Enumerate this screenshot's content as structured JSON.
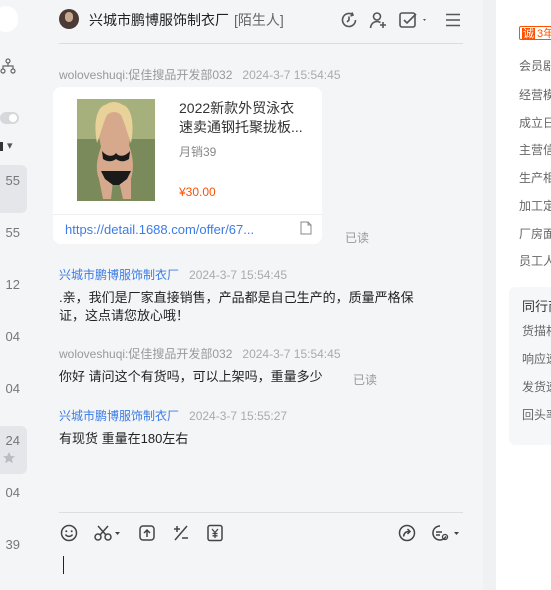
{
  "left_strip": {
    "partial_times": [
      {
        "text": "55",
        "selected": true
      },
      {
        "text": "55",
        "selected": false
      },
      {
        "text": "12",
        "selected": false
      },
      {
        "text": "04",
        "selected": false
      },
      {
        "text": "04",
        "selected": false
      },
      {
        "text": "24",
        "selected": true
      },
      {
        "text": "04",
        "selected": false
      },
      {
        "text": "39",
        "selected": false
      }
    ]
  },
  "header": {
    "title": "兴城市鹏博服饰制衣厂",
    "tag": "[陌生人]",
    "icons": [
      "clock-refresh-icon",
      "add-contact-icon",
      "checklist-icon",
      "menu-icon"
    ]
  },
  "messages": [
    {
      "sender": "woloveshuqi:促佳搜品开发部032",
      "time": "2024-3-7 15:54:45",
      "product_card": {
        "title_line1": "2022新款外贸泳衣",
        "title_line2": "速卖通钢托聚拢板...",
        "sales": "月销39",
        "price": "¥30.00",
        "link": "https://detail.1688.com/offer/67..."
      },
      "status": "已读"
    },
    {
      "sender": "兴城市鹏博服饰制衣厂",
      "time": "2024-3-7 15:54:45",
      "line1": ".亲，我们是厂家直接销售，产品都是自己生产的，质量严格保",
      "line2": "证，这点请您放心哦！"
    },
    {
      "sender": "woloveshuqi:促佳搜品开发部032",
      "time": "2024-3-7 15:54:45",
      "text": "你好 请问这个有货吗，可以上架吗，重量多少",
      "status": "已读"
    },
    {
      "sender": "兴城市鹏博服饰制衣厂",
      "time": "2024-3-7 15:55:27",
      "text": "有现货  重量在180左右"
    }
  ],
  "toolbar": {
    "icons": [
      "emoji-icon",
      "scissors-icon",
      "upload-icon",
      "plus-minus-icon",
      "yuan-receipt-icon",
      "share-icon",
      "quick-reply-icon"
    ]
  },
  "right_panel": {
    "badge_prefix": "诚",
    "badge_text": "3年",
    "labels": [
      "会员剧",
      "经营模",
      "成立日",
      "主营信",
      "生产相",
      "加工定",
      "厂房面",
      "员工人"
    ],
    "box_title": "同行商",
    "box_items": [
      "货描相",
      "响应速",
      "发货速",
      "回头率"
    ]
  },
  "colors": {
    "link_blue": "#3b7ce6",
    "price_orange": "#ff5000",
    "panel_bg": "#f4f5f7"
  }
}
